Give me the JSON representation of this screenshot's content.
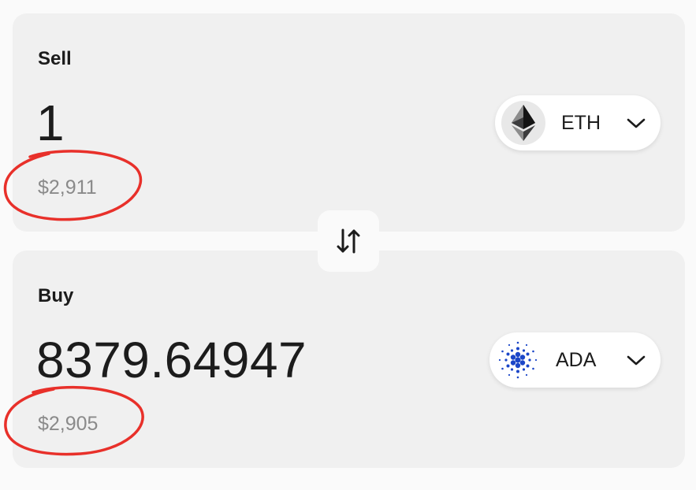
{
  "sell": {
    "label": "Sell",
    "amount": "1",
    "usd_value": "$2,911",
    "token": {
      "symbol": "ETH",
      "icon": "ethereum-logo-icon"
    }
  },
  "buy": {
    "label": "Buy",
    "amount": "8379.64947",
    "usd_value": "$2,905",
    "token": {
      "symbol": "ADA",
      "icon": "cardano-logo-icon"
    }
  },
  "swap_button": {
    "icon": "swap-arrows-icon"
  },
  "colors": {
    "background": "#fafafa",
    "panel": "#f0f0f0",
    "annotation": "#e8302a",
    "cardano_blue": "#1b46c8",
    "muted_text": "#8a8a8a"
  }
}
